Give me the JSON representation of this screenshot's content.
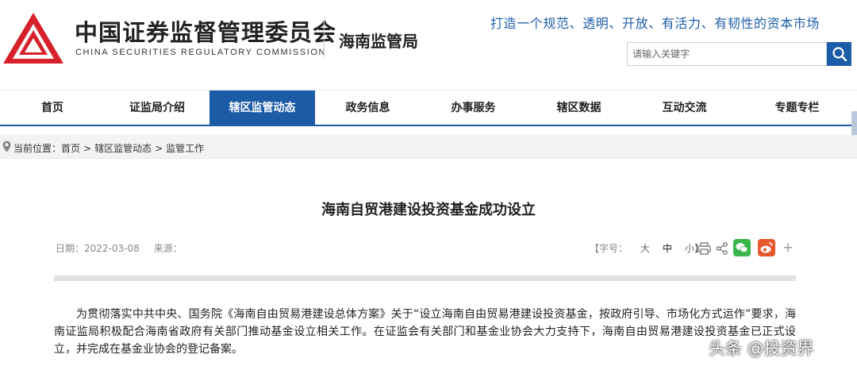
{
  "header": {
    "org_name_cn": "中国证券监督管理委员会",
    "org_name_en": "CHINA SECURITIES REGULATORY COMMISSION",
    "bureau": "海南监管局",
    "slogan": "打造一个规范、透明、开放、有活力、有韧性的资本市场",
    "search_placeholder": "请输入关键字",
    "logo_color": "#d6202a",
    "accent_color": "#1c5ba6"
  },
  "nav": {
    "items": [
      {
        "label": "首页"
      },
      {
        "label": "证监局介绍"
      },
      {
        "label": "辖区监管动态"
      },
      {
        "label": "政务信息"
      },
      {
        "label": "办事服务"
      },
      {
        "label": "辖区数据"
      },
      {
        "label": "互动交流"
      },
      {
        "label": "专题专栏"
      }
    ],
    "active": "辖区监管动态"
  },
  "breadcrumb": {
    "prefix": "当前位置：",
    "items": [
      "首页",
      "辖区监管动态",
      "监管工作"
    ],
    "separator": ">"
  },
  "article": {
    "title": "海南自贸港建设投资基金成功设立",
    "date_label": "日期：",
    "date": "2022-03-08",
    "source_label": "来源：",
    "source": "",
    "font_size_label": "【字号：",
    "font_sizes": [
      "大",
      "中",
      "小】"
    ],
    "body": "为贯彻落实中共中央、国务院《海南自由贸易港建设总体方案》关于“设立海南自由贸易港建设投资基金，按政府引导、市场化方式运作”要求，海南证监局积极配合海南省政府有关部门推动基金设立相关工作。在证监会有关部门和基金业协会大力支持下，海南自由贸易港建设投资基金已正式设立，并完成在基金业协会的登记备案。"
  },
  "tools": {
    "icons": [
      "print-icon",
      "share-icon",
      "wechat-icon",
      "weibo-icon",
      "plus-icon"
    ],
    "more_label": "+"
  },
  "watermark": "头条 @投资界"
}
